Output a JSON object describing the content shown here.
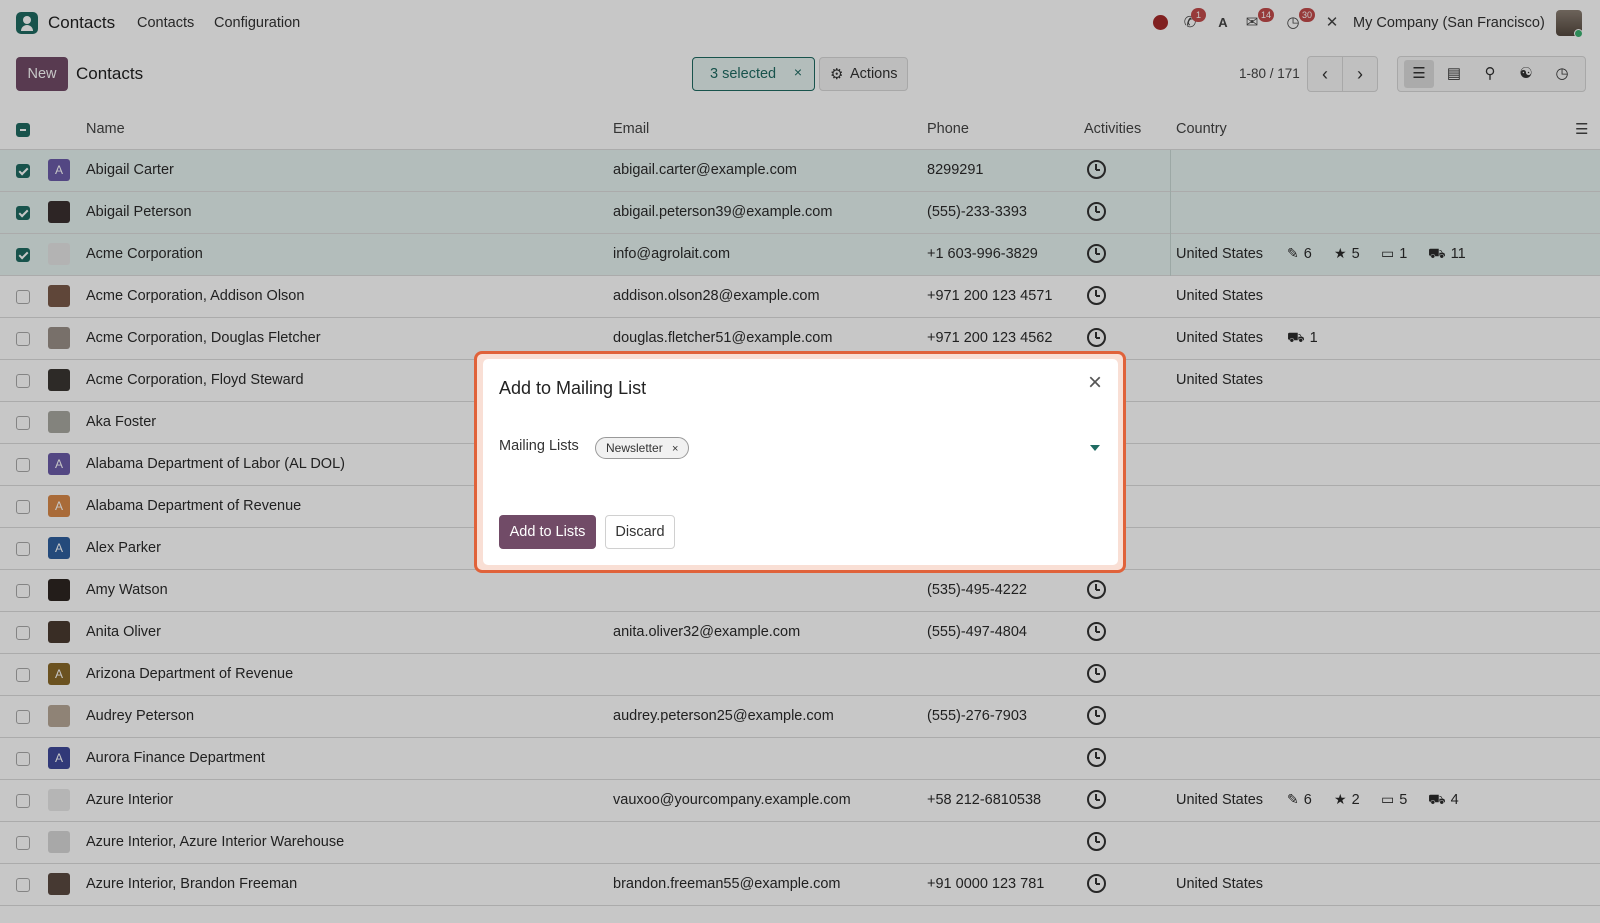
{
  "navbar": {
    "app_name": "Contacts",
    "menus": [
      "Contacts",
      "Configuration"
    ],
    "badges": {
      "phone": "1",
      "messages": "14",
      "activities": "30"
    },
    "company": "My Company (San Francisco)"
  },
  "control_panel": {
    "new_label": "New",
    "title": "Contacts",
    "selected_label": "3 selected",
    "clear_selection": "×",
    "actions_label": "Actions",
    "pager": "1-80 / 171"
  },
  "list": {
    "columns": [
      "Name",
      "Email",
      "Phone",
      "Activities",
      "Country"
    ],
    "rows": [
      {
        "name": "Abigail Carter",
        "email": "abigail.carter@example.com",
        "phone": "8299291",
        "country": "",
        "selected": true,
        "avatar_letter": "A",
        "avatar_color": "#6b5ba8"
      },
      {
        "name": "Abigail Peterson",
        "email": "abigail.peterson39@example.com",
        "phone": "(555)-233-3393",
        "country": "",
        "selected": true,
        "avatar_letter": "",
        "avatar_color": "#3a3030"
      },
      {
        "name": "Acme Corporation",
        "email": "info@agrolait.com",
        "phone": "+1 603-996-3829",
        "country": "United States",
        "selected": true,
        "avatar_letter": "",
        "avatar_color": "#e6e6e6",
        "stats": {
          "edit": "6",
          "star": "5",
          "card": "1",
          "cart": "11"
        }
      },
      {
        "name": "Acme Corporation, Addison Olson",
        "email": "addison.olson28@example.com",
        "phone": "+971 200 123 4571",
        "country": "United States",
        "selected": false,
        "avatar_letter": "",
        "avatar_color": "#7a5a4a"
      },
      {
        "name": "Acme Corporation, Douglas Fletcher",
        "email": "douglas.fletcher51@example.com",
        "phone": "+971 200 123 4562",
        "country": "United States",
        "selected": false,
        "avatar_letter": "",
        "avatar_color": "#9a9088",
        "stats": {
          "cart": "1"
        }
      },
      {
        "name": "Acme Corporation, Floyd Steward",
        "email": "",
        "phone": "",
        "country": "United States",
        "selected": false,
        "avatar_letter": "",
        "avatar_color": "#3a3632"
      },
      {
        "name": "Aka Foster",
        "email": "",
        "phone": "",
        "country": "",
        "selected": false,
        "avatar_letter": "",
        "avatar_color": "#a8a8a0"
      },
      {
        "name": "Alabama Department of Labor (AL DOL)",
        "email": "",
        "phone": "",
        "country": "",
        "selected": false,
        "avatar_letter": "A",
        "avatar_color": "#6b5ba8"
      },
      {
        "name": "Alabama Department of Revenue",
        "email": "",
        "phone": "",
        "country": "",
        "selected": false,
        "avatar_letter": "A",
        "avatar_color": "#d9894a"
      },
      {
        "name": "Alex Parker",
        "email": "",
        "phone": "",
        "country": "",
        "selected": false,
        "avatar_letter": "A",
        "avatar_color": "#2f5f9e"
      },
      {
        "name": "Amy Watson",
        "email": "",
        "phone": "(535)-495-4222",
        "country": "",
        "selected": false,
        "avatar_letter": "",
        "avatar_color": "#2e2622"
      },
      {
        "name": "Anita Oliver",
        "email": "anita.oliver32@example.com",
        "phone": "(555)-497-4804",
        "country": "",
        "selected": false,
        "avatar_letter": "",
        "avatar_color": "#4a3a30"
      },
      {
        "name": "Arizona Department of Revenue",
        "email": "",
        "phone": "",
        "country": "",
        "selected": false,
        "avatar_letter": "A",
        "avatar_color": "#8a6a2a"
      },
      {
        "name": "Audrey Peterson",
        "email": "audrey.peterson25@example.com",
        "phone": "(555)-276-7903",
        "country": "",
        "selected": false,
        "avatar_letter": "",
        "avatar_color": "#b8a898"
      },
      {
        "name": "Aurora Finance Department",
        "email": "",
        "phone": "",
        "country": "",
        "selected": false,
        "avatar_letter": "A",
        "avatar_color": "#3f4a9a"
      },
      {
        "name": "Azure Interior",
        "email": "vauxoo@yourcompany.example.com",
        "phone": "+58 212-6810538",
        "country": "United States",
        "selected": false,
        "avatar_letter": "",
        "avatar_color": "#e8e8e8",
        "stats": {
          "edit": "6",
          "star": "2",
          "card": "5",
          "cart": "4"
        }
      },
      {
        "name": "Azure Interior, Azure Interior Warehouse",
        "email": "",
        "phone": "",
        "country": "",
        "selected": false,
        "avatar_letter": "",
        "avatar_color": "#d8d8d8"
      },
      {
        "name": "Azure Interior, Brandon Freeman",
        "email": "brandon.freeman55@example.com",
        "phone": "+91 0000 123 781",
        "country": "United States",
        "selected": false,
        "avatar_letter": "",
        "avatar_color": "#5a4a40"
      }
    ]
  },
  "modal": {
    "title": "Add to Mailing List",
    "close": "×",
    "field_label": "Mailing Lists",
    "tag": "Newsletter",
    "tag_remove": "×",
    "primary_label": "Add to Lists",
    "secondary_label": "Discard"
  },
  "colors": {
    "brand": "#714b67",
    "accent": "#1f6b62",
    "selected_row": "#e6f2f0",
    "highlight": "#e0623a"
  }
}
